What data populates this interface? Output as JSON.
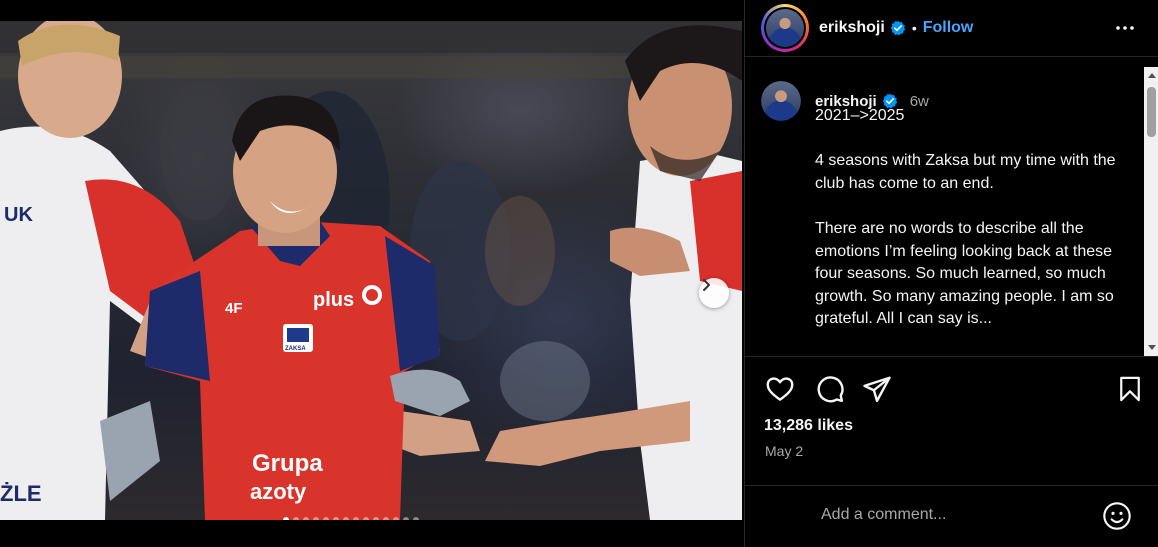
{
  "header": {
    "username": "erikshoji",
    "separator": "•",
    "follow_label": "Follow"
  },
  "caption": {
    "username": "erikshoji",
    "time": "6w",
    "text": "2021–>2025\n\n4 seasons with Zaksa but my time with the club has come to an end.\n\nThere are no words to describe all the emotions I’m feeling looking back at these four seasons. So much learned, so much growth. So many amazing people. I am so grateful. All I can say is..."
  },
  "jersey": {
    "sponsor_plus": "plus",
    "sponsor_4f": "4F",
    "sponsor_grupa": "Grupa",
    "sponsor_azoty": "azoty",
    "club_badge": "ZAKSA",
    "left_player_name": "ŻLE",
    "left_player_top": "UK"
  },
  "post": {
    "likes": "13,286 likes",
    "date": "May 2"
  },
  "comment": {
    "placeholder": "Add a comment..."
  },
  "carousel": {
    "total_slides": 14,
    "active_index": 0
  },
  "icons": {
    "verified": "verified-badge-icon",
    "more": "more-options-icon",
    "like": "heart-icon",
    "comment": "comment-bubble-icon",
    "share": "paper-plane-icon",
    "save": "bookmark-icon",
    "emoji": "emoji-smiley-icon",
    "next": "chevron-right-icon"
  },
  "colors": {
    "accent": "#0095f6",
    "follow": "#4aa3ff",
    "muted": "#a8a8a8",
    "jersey_red": "#d9342b",
    "jersey_navy": "#1e2b6b"
  }
}
